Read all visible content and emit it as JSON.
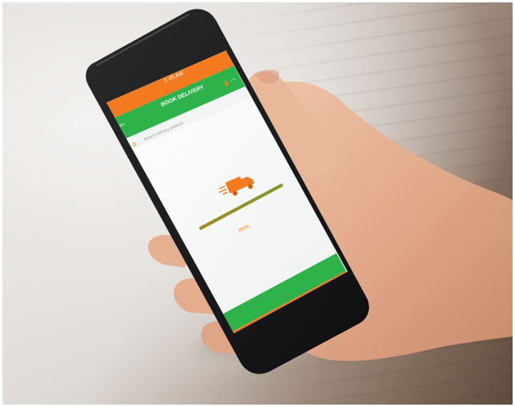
{
  "scene": {
    "description_free": true,
    "colors": {
      "accent_orange": "#f47a1f",
      "accent_green": "#2db34a",
      "screen_white": "#f5f7f6",
      "phone_body": "#1b1b1d",
      "skin": "#e7b79a",
      "progress_bar": "#8a9a2a"
    }
  },
  "app": {
    "status_time": "1:45 AM",
    "title": "BOOK DELIVERY",
    "subtitle": "Search delivery address",
    "progress_label": "100%",
    "progress": 1.0,
    "icons": [
      "back-arrow-icon",
      "user-icon",
      "wifi-icon",
      "home-icon",
      "delivery-truck-icon"
    ]
  }
}
